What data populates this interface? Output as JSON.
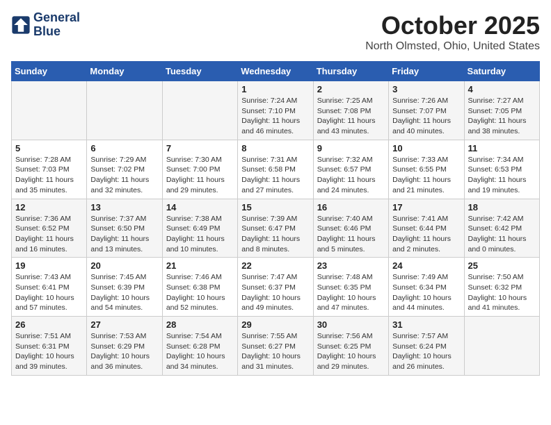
{
  "logo": {
    "line1": "General",
    "line2": "Blue"
  },
  "title": "October 2025",
  "subtitle": "North Olmsted, Ohio, United States",
  "weekdays": [
    "Sunday",
    "Monday",
    "Tuesday",
    "Wednesday",
    "Thursday",
    "Friday",
    "Saturday"
  ],
  "weeks": [
    [
      {
        "day": "",
        "info": ""
      },
      {
        "day": "",
        "info": ""
      },
      {
        "day": "",
        "info": ""
      },
      {
        "day": "1",
        "info": "Sunrise: 7:24 AM\nSunset: 7:10 PM\nDaylight: 11 hours and 46 minutes."
      },
      {
        "day": "2",
        "info": "Sunrise: 7:25 AM\nSunset: 7:08 PM\nDaylight: 11 hours and 43 minutes."
      },
      {
        "day": "3",
        "info": "Sunrise: 7:26 AM\nSunset: 7:07 PM\nDaylight: 11 hours and 40 minutes."
      },
      {
        "day": "4",
        "info": "Sunrise: 7:27 AM\nSunset: 7:05 PM\nDaylight: 11 hours and 38 minutes."
      }
    ],
    [
      {
        "day": "5",
        "info": "Sunrise: 7:28 AM\nSunset: 7:03 PM\nDaylight: 11 hours and 35 minutes."
      },
      {
        "day": "6",
        "info": "Sunrise: 7:29 AM\nSunset: 7:02 PM\nDaylight: 11 hours and 32 minutes."
      },
      {
        "day": "7",
        "info": "Sunrise: 7:30 AM\nSunset: 7:00 PM\nDaylight: 11 hours and 29 minutes."
      },
      {
        "day": "8",
        "info": "Sunrise: 7:31 AM\nSunset: 6:58 PM\nDaylight: 11 hours and 27 minutes."
      },
      {
        "day": "9",
        "info": "Sunrise: 7:32 AM\nSunset: 6:57 PM\nDaylight: 11 hours and 24 minutes."
      },
      {
        "day": "10",
        "info": "Sunrise: 7:33 AM\nSunset: 6:55 PM\nDaylight: 11 hours and 21 minutes."
      },
      {
        "day": "11",
        "info": "Sunrise: 7:34 AM\nSunset: 6:53 PM\nDaylight: 11 hours and 19 minutes."
      }
    ],
    [
      {
        "day": "12",
        "info": "Sunrise: 7:36 AM\nSunset: 6:52 PM\nDaylight: 11 hours and 16 minutes."
      },
      {
        "day": "13",
        "info": "Sunrise: 7:37 AM\nSunset: 6:50 PM\nDaylight: 11 hours and 13 minutes."
      },
      {
        "day": "14",
        "info": "Sunrise: 7:38 AM\nSunset: 6:49 PM\nDaylight: 11 hours and 10 minutes."
      },
      {
        "day": "15",
        "info": "Sunrise: 7:39 AM\nSunset: 6:47 PM\nDaylight: 11 hours and 8 minutes."
      },
      {
        "day": "16",
        "info": "Sunrise: 7:40 AM\nSunset: 6:46 PM\nDaylight: 11 hours and 5 minutes."
      },
      {
        "day": "17",
        "info": "Sunrise: 7:41 AM\nSunset: 6:44 PM\nDaylight: 11 hours and 2 minutes."
      },
      {
        "day": "18",
        "info": "Sunrise: 7:42 AM\nSunset: 6:42 PM\nDaylight: 11 hours and 0 minutes."
      }
    ],
    [
      {
        "day": "19",
        "info": "Sunrise: 7:43 AM\nSunset: 6:41 PM\nDaylight: 10 hours and 57 minutes."
      },
      {
        "day": "20",
        "info": "Sunrise: 7:45 AM\nSunset: 6:39 PM\nDaylight: 10 hours and 54 minutes."
      },
      {
        "day": "21",
        "info": "Sunrise: 7:46 AM\nSunset: 6:38 PM\nDaylight: 10 hours and 52 minutes."
      },
      {
        "day": "22",
        "info": "Sunrise: 7:47 AM\nSunset: 6:37 PM\nDaylight: 10 hours and 49 minutes."
      },
      {
        "day": "23",
        "info": "Sunrise: 7:48 AM\nSunset: 6:35 PM\nDaylight: 10 hours and 47 minutes."
      },
      {
        "day": "24",
        "info": "Sunrise: 7:49 AM\nSunset: 6:34 PM\nDaylight: 10 hours and 44 minutes."
      },
      {
        "day": "25",
        "info": "Sunrise: 7:50 AM\nSunset: 6:32 PM\nDaylight: 10 hours and 41 minutes."
      }
    ],
    [
      {
        "day": "26",
        "info": "Sunrise: 7:51 AM\nSunset: 6:31 PM\nDaylight: 10 hours and 39 minutes."
      },
      {
        "day": "27",
        "info": "Sunrise: 7:53 AM\nSunset: 6:29 PM\nDaylight: 10 hours and 36 minutes."
      },
      {
        "day": "28",
        "info": "Sunrise: 7:54 AM\nSunset: 6:28 PM\nDaylight: 10 hours and 34 minutes."
      },
      {
        "day": "29",
        "info": "Sunrise: 7:55 AM\nSunset: 6:27 PM\nDaylight: 10 hours and 31 minutes."
      },
      {
        "day": "30",
        "info": "Sunrise: 7:56 AM\nSunset: 6:25 PM\nDaylight: 10 hours and 29 minutes."
      },
      {
        "day": "31",
        "info": "Sunrise: 7:57 AM\nSunset: 6:24 PM\nDaylight: 10 hours and 26 minutes."
      },
      {
        "day": "",
        "info": ""
      }
    ]
  ]
}
